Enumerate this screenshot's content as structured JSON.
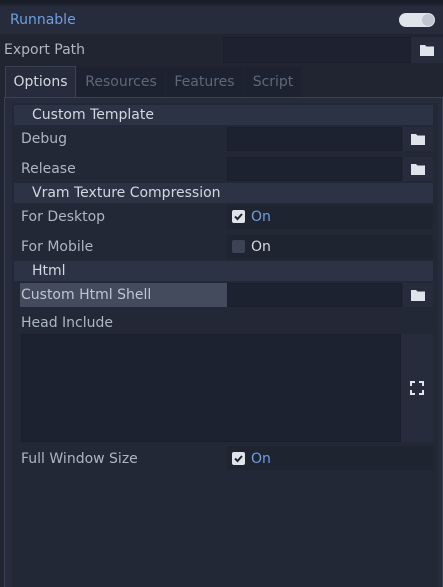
{
  "runnable": {
    "label": "Runnable",
    "enabled": true
  },
  "export_path": {
    "label": "Export Path",
    "value": ""
  },
  "tabs": [
    {
      "label": "Options",
      "active": true
    },
    {
      "label": "Resources",
      "active": false
    },
    {
      "label": "Features",
      "active": false
    },
    {
      "label": "Script",
      "active": false
    }
  ],
  "sections": {
    "custom_template": "Custom Template",
    "vram": "Vram Texture Compression",
    "html": "Html"
  },
  "fields": {
    "debug": "Debug",
    "release": "Release",
    "for_desktop": {
      "label": "For Desktop",
      "value_label": "On",
      "checked": true
    },
    "for_mobile": {
      "label": "For Mobile",
      "value_label": "On",
      "checked": false
    },
    "custom_html_shell": "Custom Html Shell",
    "head_include": "Head Include",
    "full_window_size": {
      "label": "Full Window Size",
      "value_label": "On",
      "checked": true
    }
  },
  "icons": {
    "folder": "folder-icon",
    "expand": "expand-icon",
    "check": "checkmark-icon"
  },
  "colors": {
    "accent": "#6f9fe0",
    "background": "#202531",
    "panel": "#262c3b"
  }
}
